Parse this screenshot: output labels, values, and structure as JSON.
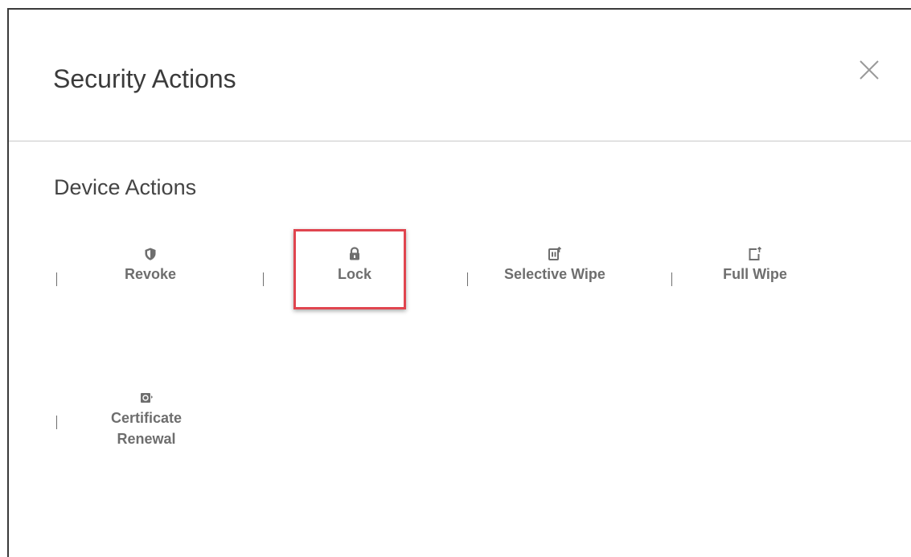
{
  "dialog": {
    "title": "Security Actions",
    "close_icon": "close-icon"
  },
  "section": {
    "title": "Device Actions"
  },
  "actions": [
    {
      "label": "Revoke",
      "icon": "shield-icon"
    },
    {
      "label": "Lock",
      "icon": "lock-icon",
      "highlighted": true
    },
    {
      "label": "Selective Wipe",
      "icon": "selective-wipe-icon"
    },
    {
      "label": "Full Wipe",
      "icon": "full-wipe-icon"
    },
    {
      "label_lines": [
        "Certificate",
        "Renewal"
      ],
      "icon": "certificate-renewal-icon"
    }
  ],
  "colors": {
    "highlight": "#e0454f",
    "text_muted": "#6e6e6e",
    "title": "#3b3b3b"
  }
}
